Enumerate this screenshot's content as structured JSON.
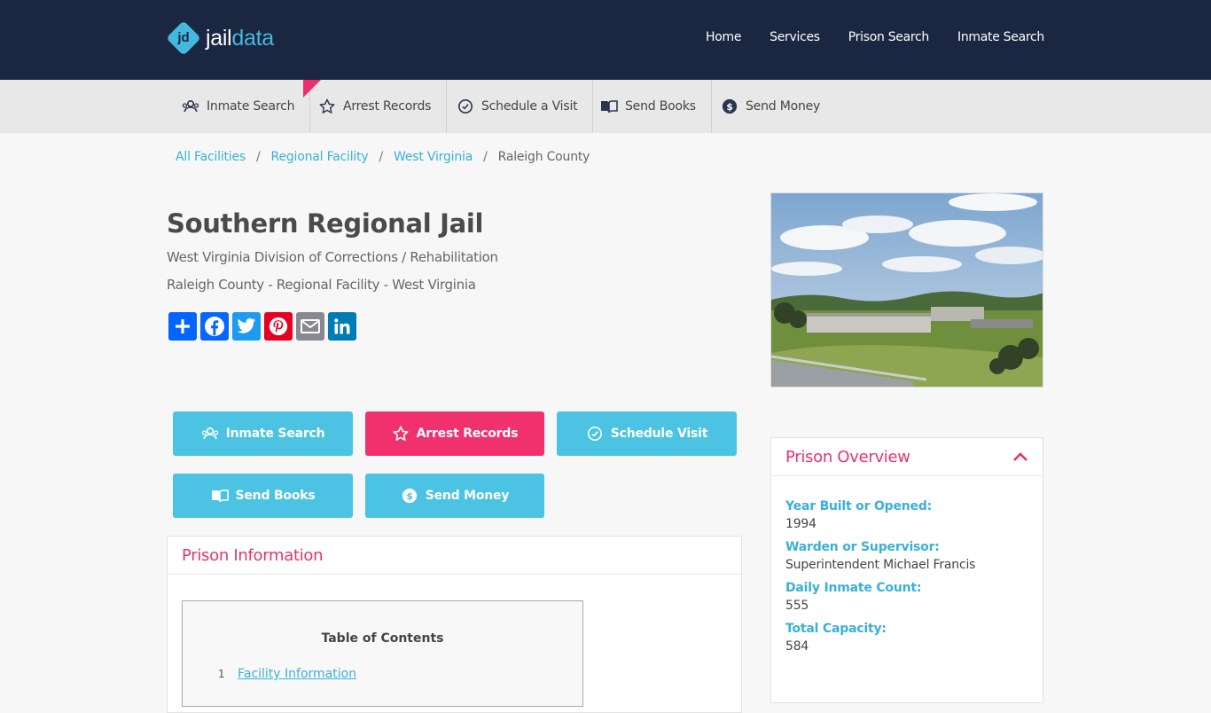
{
  "brand": {
    "logo_mark": "jd",
    "name_part1": "jail",
    "name_part2": "data"
  },
  "top_nav": [
    "Home",
    "Services",
    "Prison Search",
    "Inmate Search"
  ],
  "sub_nav": [
    {
      "label": "Inmate Search",
      "icon": "inmate-icon"
    },
    {
      "label": "Arrest Records",
      "icon": "star-icon"
    },
    {
      "label": "Schedule a Visit",
      "icon": "clock-icon"
    },
    {
      "label": "Send Books",
      "icon": "book-icon"
    },
    {
      "label": "Send Money",
      "icon": "money-icon"
    }
  ],
  "breadcrumb": [
    "All Facilities",
    "Regional Facility",
    "West Virginia",
    "Raleigh County"
  ],
  "breadcrumb_sep": "/",
  "title": "Southern Regional Jail",
  "subtitle1": "West Virginia Division of Corrections / Rehabilitation",
  "subtitle2": "Raleigh County - Regional Facility - West Virginia",
  "share": [
    {
      "name": "share-add-icon",
      "color": "#0166ff"
    },
    {
      "name": "facebook-icon",
      "color": "#0866ff"
    },
    {
      "name": "twitter-icon",
      "color": "#1d9bf0"
    },
    {
      "name": "pinterest-icon",
      "color": "#e60023"
    },
    {
      "name": "email-icon",
      "color": "#888990"
    },
    {
      "name": "linkedin-icon",
      "color": "#007bb5"
    }
  ],
  "actions": {
    "inmate_search": "Inmate Search",
    "arrest_records": "Arrest Records",
    "schedule_visit": "Schedule Visit",
    "send_books": "Send Books",
    "send_money": "Send Money"
  },
  "colors": {
    "accent_blue": "#4cc3e2",
    "accent_pink": "#f1306e",
    "header_bg": "#1b2640"
  },
  "info_panel": {
    "title": "Prison Information",
    "toc_title": "Table of Contents",
    "toc_items": [
      {
        "num": "1",
        "label": "Facility Information"
      }
    ]
  },
  "overview": {
    "title": "Prison Overview",
    "fields": [
      {
        "label": "Year Built or Opened:",
        "value": "1994"
      },
      {
        "label": "Warden or Supervisor:",
        "value": "Superintendent Michael Francis"
      },
      {
        "label": "Daily Inmate Count:",
        "value": "555"
      },
      {
        "label": "Total Capacity:",
        "value": "584"
      }
    ]
  }
}
